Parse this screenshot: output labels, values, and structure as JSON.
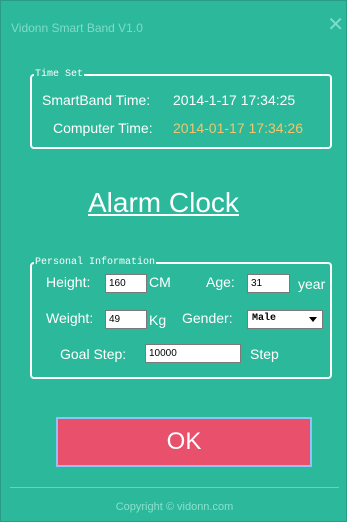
{
  "window": {
    "title": "Vidonn Smart Band V1.0",
    "close_symbol": "✕"
  },
  "time_set": {
    "legend": "Time Set",
    "smartband_label": "SmartBand Time:",
    "smartband_value": "2014-1-17 17:34:25",
    "computer_label": "Computer Time:",
    "computer_value": "2014-01-17 17:34:26"
  },
  "alarm_clock_link": "Alarm Clock",
  "personal_info": {
    "legend": "Personal Information",
    "height_label": "Height:",
    "height_value": "160",
    "height_unit": "CM",
    "age_label": "Age:",
    "age_value": "31",
    "age_unit": "year",
    "weight_label": "Weight:",
    "weight_value": "49",
    "weight_unit": "Kg",
    "gender_label": "Gender:",
    "gender_value": "Male",
    "goal_label": "Goal Step:",
    "goal_value": "10000",
    "goal_unit": "Step"
  },
  "ok_button": "OK",
  "footer": {
    "copyright": "Copyright © vidonn.com"
  },
  "colors": {
    "background": "#2bb89b",
    "ok_button": "#e8506b",
    "computer_time": "#f5c46a"
  }
}
